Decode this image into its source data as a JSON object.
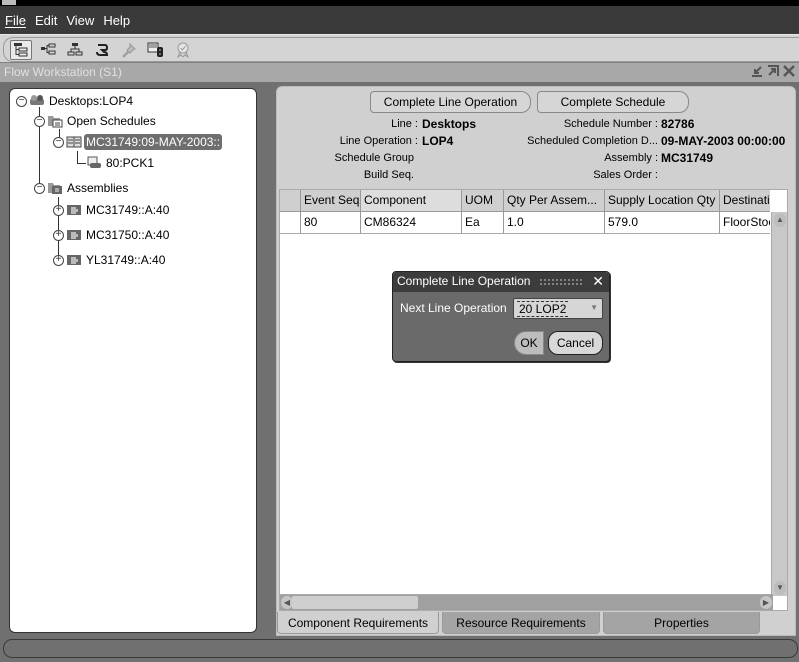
{
  "menubar": {
    "items": [
      {
        "label": "File",
        "mnemonic": "F"
      },
      {
        "label": "Edit",
        "mnemonic": "E"
      },
      {
        "label": "View",
        "mnemonic": "V"
      },
      {
        "label": "Help",
        "mnemonic": "H"
      }
    ]
  },
  "toolbar": {
    "buttons": [
      {
        "icon": "tree-view-icon",
        "active": true
      },
      {
        "icon": "horizontal-tree-icon",
        "active": false
      },
      {
        "icon": "hierarchy-icon",
        "active": false
      },
      {
        "icon": "refresh-icon",
        "active": false
      },
      {
        "icon": "pushpin-icon",
        "active": false
      },
      {
        "icon": "monitor-traffic-light-icon",
        "active": false
      },
      {
        "icon": "award-ribbon-icon",
        "active": false
      }
    ]
  },
  "window": {
    "title": "Flow Workstation  (S1)",
    "controls": [
      "minimize-icon",
      "maximize-icon",
      "close-icon"
    ]
  },
  "tree": {
    "root": {
      "label": "Desktops:LOP4",
      "expanded": true
    },
    "open_schedules": {
      "label": "Open Schedules",
      "expanded": true
    },
    "schedule": {
      "label": "MC31749:09-MAY-2003::",
      "expanded": true,
      "selected": true
    },
    "operation": {
      "label": "80:PCK1"
    },
    "assemblies": {
      "label": "Assemblies",
      "expanded": true
    },
    "assembly_items": [
      {
        "label": "MC31749::A:40",
        "expanded": false
      },
      {
        "label": "MC31750::A:40",
        "expanded": false
      },
      {
        "label": "YL31749::A:40",
        "expanded": false
      }
    ]
  },
  "header": {
    "complete_line_operation_button": "Complete Line Operation",
    "complete_schedule_button": "Complete Schedule",
    "left_fields": [
      {
        "label": "Line :",
        "value": "Desktops"
      },
      {
        "label": "Line Operation :",
        "value": "LOP4"
      },
      {
        "label": "Schedule Group",
        "value": ""
      },
      {
        "label": "Build Seq.",
        "value": ""
      }
    ],
    "right_fields": [
      {
        "label": "Schedule Number :",
        "value": "82786"
      },
      {
        "label": "Scheduled Completion D...",
        "value": "09-MAY-2003 00:00:00"
      },
      {
        "label": "Assembly :",
        "value": "MC31749"
      },
      {
        "label": "Sales Order :",
        "value": ""
      }
    ]
  },
  "grid": {
    "columns": [
      "",
      "Event Seq",
      "Component",
      "UOM",
      "Qty Per Assem...",
      "Supply Location Qty",
      "Destinati"
    ],
    "rows": [
      [
        "",
        "80",
        "CM86324",
        "Ea",
        "1.0",
        "579.0",
        "FloorStoc"
      ]
    ]
  },
  "tabs": [
    {
      "label": "Component Requirements",
      "active": true
    },
    {
      "label": "Resource Requirements",
      "active": false
    },
    {
      "label": "Properties",
      "active": false
    }
  ],
  "dialog": {
    "title": "Complete Line Operation",
    "field_label": "Next Line Operation",
    "selected_value": "20 LOP2",
    "ok_label": "OK",
    "cancel_label": "Cancel"
  }
}
